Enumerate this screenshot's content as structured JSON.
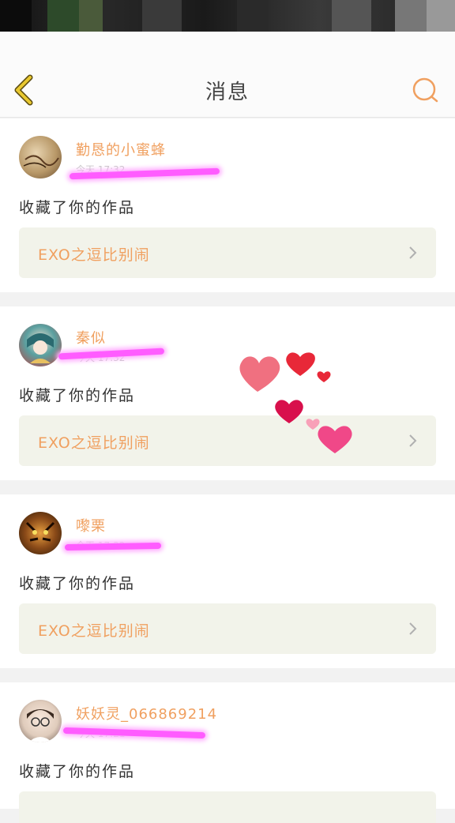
{
  "header": {
    "title": "消息",
    "back_icon": "chevron-left-icon",
    "search_icon": "search-icon",
    "icon_color": "#f0a060",
    "back_color": "#e8c830"
  },
  "messages": [
    {
      "username": "勤恳的小蜜蜂",
      "time": "今天 17:32",
      "action": "收藏了你的作品",
      "work_title": "EXO之逗比别闹"
    },
    {
      "username": "秦似",
      "time": "今天 17:32",
      "action": "收藏了你的作品",
      "work_title": "EXO之逗比别闹"
    },
    {
      "username": "嚟栗",
      "time": "今天 17:32",
      "action": "收藏了你的作品",
      "work_title": "EXO之逗比别闹"
    },
    {
      "username": "妖妖灵_066869214",
      "time": "今天 17:21",
      "action": "收藏了你的作品",
      "work_title": ""
    }
  ],
  "colors": {
    "accent": "#f0a060",
    "redaction": "#ff5cff",
    "heart": "#f0506a"
  }
}
